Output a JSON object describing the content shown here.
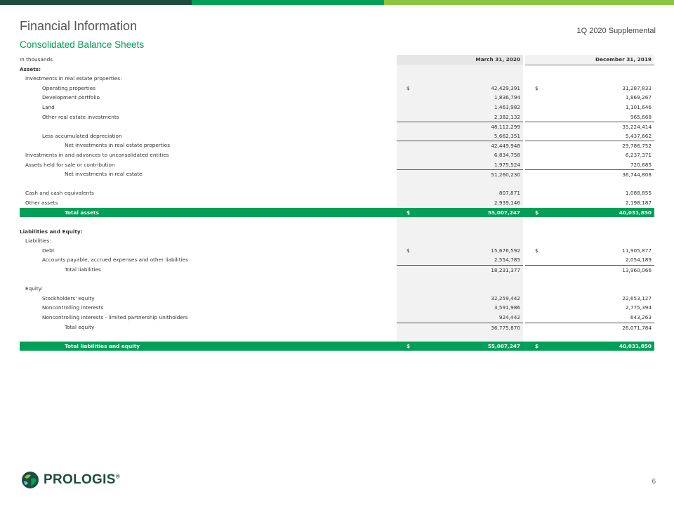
{
  "header": {
    "title": "Financial Information",
    "subtitle": "Consolidated Balance Sheets",
    "supplemental": "1Q 2020 Supplemental"
  },
  "table": {
    "unit_label": "In thousands",
    "col1_header": "March 31, 2020",
    "col2_header": "December 31, 2019",
    "rows": [
      {
        "label": "Assets:",
        "indent": 0,
        "bold": true
      },
      {
        "label": "Investments in real estate properties:",
        "indent": 1
      },
      {
        "label": "Operating properties",
        "indent": 2,
        "v1": "42,429,391",
        "v2": "31,287,833",
        "dollar": true
      },
      {
        "label": "Development portfolio",
        "indent": 2,
        "v1": "1,836,794",
        "v2": "1,869,267"
      },
      {
        "label": "Land",
        "indent": 2,
        "v1": "1,463,982",
        "v2": "1,101,646"
      },
      {
        "label": "Other real estate investments",
        "indent": 2,
        "v1": "2,382,132",
        "v2": "965,668"
      },
      {
        "label": "",
        "indent": 2,
        "v1": "48,112,299",
        "v2": "35,224,414",
        "topline": true
      },
      {
        "label": "Less accumulated depreciation",
        "indent": 2,
        "v1": "5,662,351",
        "v2": "5,437,662"
      },
      {
        "label": "Net investments in real estate properties",
        "indent": 3,
        "v1": "42,449,948",
        "v2": "29,786,752",
        "topline": true
      },
      {
        "label": "Investments in and advances to unconsolidated entities",
        "indent": 1,
        "v1": "6,834,758",
        "v2": "6,237,371"
      },
      {
        "label": "Assets held for sale or contribution",
        "indent": 1,
        "v1": "1,975,524",
        "v2": "720,685"
      },
      {
        "label": "Net investments in real estate",
        "indent": 3,
        "v1": "51,260,230",
        "v2": "36,744,808",
        "topline": true
      },
      {
        "label": "",
        "indent": 0
      },
      {
        "label": "Cash and cash equivalents",
        "indent": 1,
        "v1": "807,871",
        "v2": "1,088,855"
      },
      {
        "label": "Other assets",
        "indent": 1,
        "v1": "2,939,146",
        "v2": "2,198,187"
      },
      {
        "label": "Total assets",
        "indent": 3,
        "v1": "55,007,247",
        "v2": "40,031,850",
        "dollar": true,
        "total": true
      },
      {
        "label": "",
        "indent": 0
      },
      {
        "label": "Liabilities and Equity:",
        "indent": 0,
        "bold": true
      },
      {
        "label": "Liabilities:",
        "indent": 1
      },
      {
        "label": "Debt",
        "indent": 2,
        "v1": "15,676,592",
        "v2": "11,905,877",
        "dollar": true
      },
      {
        "label": "Accounts payable, accrued expenses and other liabilities",
        "indent": 2,
        "v1": "2,554,785",
        "v2": "2,054,189"
      },
      {
        "label": "Total liabilities",
        "indent": 3,
        "v1": "18,231,377",
        "v2": "13,960,066",
        "topline": true
      },
      {
        "label": "",
        "indent": 0
      },
      {
        "label": "Equity:",
        "indent": 1
      },
      {
        "label": "Stockholders' equity",
        "indent": 2,
        "v1": "32,259,442",
        "v2": "22,653,127"
      },
      {
        "label": "Noncontrolling interests",
        "indent": 2,
        "v1": "3,591,986",
        "v2": "2,775,394"
      },
      {
        "label": "Noncontrolling interests - limited partnership unitholders",
        "indent": 2,
        "v1": "924,442",
        "v2": "643,263"
      },
      {
        "label": "Total equity",
        "indent": 3,
        "v1": "36,775,870",
        "v2": "26,071,784",
        "topline": true
      },
      {
        "label": "",
        "indent": 0
      },
      {
        "label": "Total liabilities and equity",
        "indent": 3,
        "v1": "55,007,247",
        "v2": "40,031,850",
        "dollar": true,
        "total": true
      }
    ]
  },
  "footer": {
    "logo_text": "PROLOGIS",
    "logo_mark": "®",
    "page_number": "6"
  },
  "colors": {
    "brand_green": "#00a057",
    "dark_green": "#1e4d3f",
    "light_green": "#8cc63f"
  }
}
